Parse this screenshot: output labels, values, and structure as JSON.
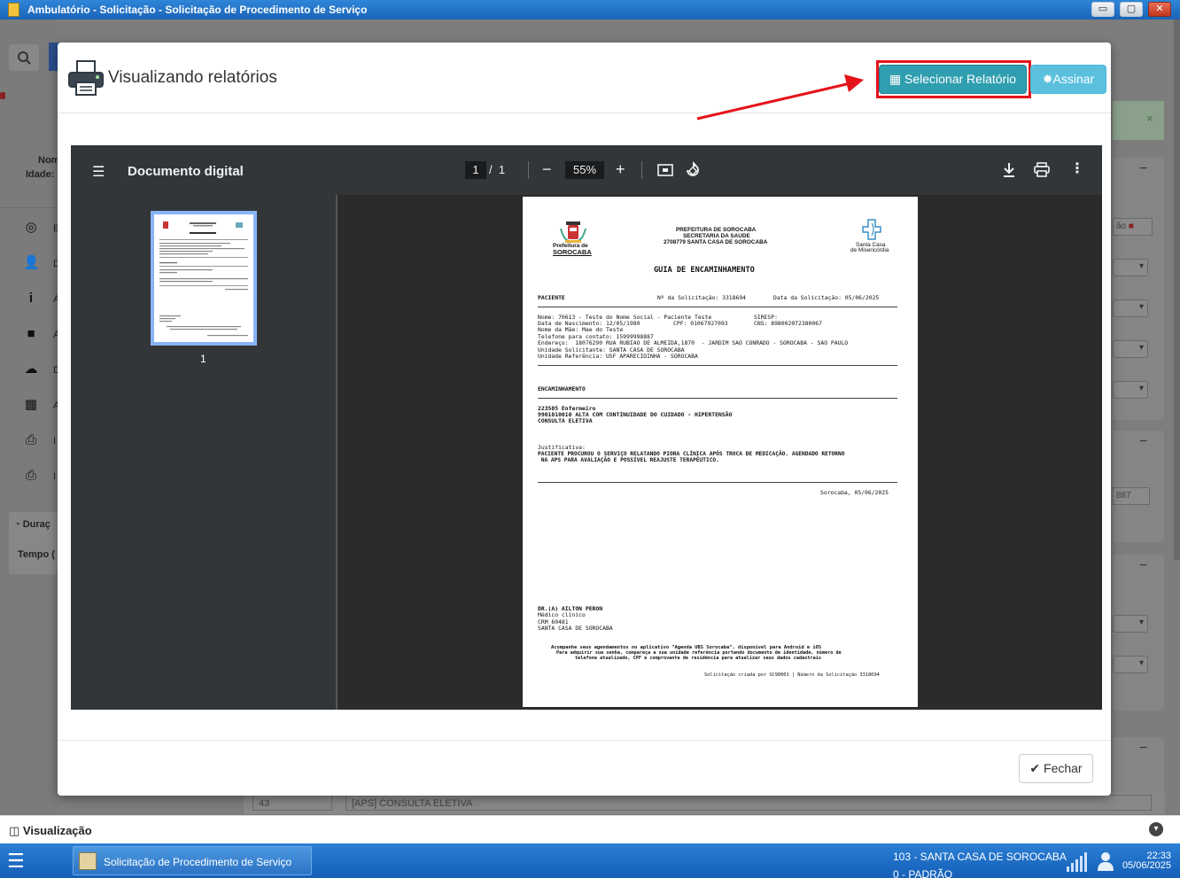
{
  "window": {
    "title": "Ambulatório - Solicitação - Solicitação de Procedimento de Serviço",
    "minimize_glyph": "▭",
    "maximize_glyph": "▢",
    "close_glyph": "✕"
  },
  "background": {
    "name_label": "Nom",
    "age_label": "Idade:",
    "sidebar_items": [
      "E",
      "D",
      "A",
      "A",
      "D",
      "A",
      "I",
      "I"
    ],
    "duration_label": "Duraç",
    "time_label": "Tempo (",
    "right_field_1": "ão",
    "right_field_2": "887",
    "bottom_field_code": "43",
    "bottom_field_desc": "[APS] CONSULTA ELETIVA"
  },
  "modal": {
    "title": "Visualizando relatórios",
    "select_report_label": "Selecionar Relatório",
    "sign_label": "Assinar",
    "close_label": "Fechar"
  },
  "viewer": {
    "doc_title": "Documento digital",
    "current_page": "1",
    "page_separator": "/",
    "total_pages": "1",
    "zoom": "55%",
    "thumb_page_number": "1"
  },
  "document": {
    "city_logo_text_1": "Prefeitura de",
    "city_logo_text_2": "SOROCABA",
    "header_1": "PREFEITURA DE SOROCABA",
    "header_2": "SECRETARIA DA SAUDE",
    "header_3": "2708779 SANTA CASA DE SOROCABA",
    "hospital_logo_1": "Santa Casa",
    "hospital_logo_2": "de Misericórdia",
    "guide_title": "GUIA DE ENCAMINHAMENTO",
    "section_patient": "PACIENTE",
    "request_number": "Nº da Solicitação: 3318694",
    "request_date": "Data da Solicitação: 05/06/2025",
    "patient_name": "Nome: 70613 - Teste do Nome Social - Paciente Teste",
    "siresp": "SIRESP:",
    "birth_date": "Data de Nascimento: 12/05/1980",
    "cpf": "CPF: 01067927093",
    "cns": "CNS: 898002072380067",
    "mother_name": "Nome da Mãe: Mae do Teste",
    "phone": "Telefone para contato: 15999998887",
    "address": "Endereço:  18076290 RUA RUBIAO DE ALMEIDA,1870  - JARDIM SAO CONRADO - SOROCABA - SAO PAULO",
    "requesting_unit": "Unidade Solicitante: SANTA CASA DE SOROCABA",
    "reference_unit": "Unidade Referência: USF APARECIDINHA - SOROCABA",
    "section_referral": "ENCAMINHAMENTO",
    "referral_1": "223505 Enfermeiro",
    "referral_2": "9901010010 ALTA COM CONTINUIDADE DO CUIDADO - HIPERTENSÃO",
    "referral_3": "CONSULTA ELETIVA",
    "justification_label": "Justificativa:",
    "justification_1": "PACIENTE PROCUROU O SERVIÇO RELATANDO PIORA CLÍNICA APÓS TROCA DE MEDICAÇÃO. AGENDADO RETORNO",
    "justification_2": " NA APS PARA AVALIAÇÃO E POSSÍVEL REAJUSTE TERAPÊUTICO.",
    "place_date": "Sorocaba, 05/06/2025",
    "doctor_name": "DR.(A) AILTON PERON",
    "doctor_role": "Médico clínico",
    "doctor_crm": "CRM 60481",
    "doctor_unit": "SANTA CASA DE SOROCABA",
    "notice_1": "Acompanhe seus agendamentos no aplicativo \"Agenda UBS Sorocaba\", disponível para Android e iOS",
    "notice_2": "Para adquirir sua senha, compareça a sua unidade referência portando documento de identidade, número de",
    "notice_3": "telefone atualizado, CPF e comprovante de residência para atualizar seus dados cadastrais",
    "footer": "Solicitação criada por SC90001 | Número da Solicitação 3318694"
  },
  "bottom": {
    "visualization_label": "Visualização",
    "task_label": "Solicitação de Procedimento de Serviço",
    "institution": "103 - SANTA CASA DE SOROCABA",
    "profile": "0 - PADRÃO",
    "time": "22:33",
    "date": "05/06/2025"
  },
  "colors": {
    "select_button": "#2f9fb0",
    "sign_button": "#5bc0de",
    "highlight": "#e5131a",
    "viewer_toolbar": "#323639",
    "taskbar": "#1a6fc8"
  },
  "icons": [
    "printer-icon",
    "table-icon",
    "badge-icon",
    "check-circle-icon",
    "menu-icon",
    "minus-icon",
    "plus-icon",
    "fit-page-icon",
    "rotate-icon",
    "download-icon",
    "print-icon",
    "more-vert-icon",
    "chevron-down-icon",
    "signal-icon",
    "user-icon"
  ]
}
